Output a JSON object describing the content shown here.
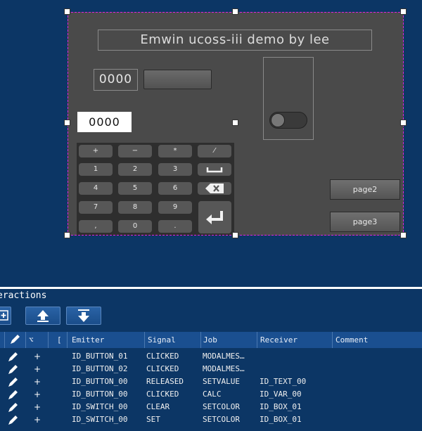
{
  "canvas": {
    "title": "Emwin ucoss-iii demo by lee",
    "display_value": "0000",
    "number_field": "0000",
    "keypad": {
      "row1": [
        "+",
        "−",
        "*",
        "⁄"
      ],
      "row2": [
        "1",
        "2",
        "3"
      ],
      "row3": [
        "4",
        "5",
        "6"
      ],
      "row4": [
        "7",
        "8",
        "9"
      ],
      "row5": [
        ",",
        "0",
        "."
      ]
    },
    "page2_label": "page2",
    "page3_label": "page3"
  },
  "panel": {
    "title": "eractions",
    "headers": [
      "Emitter",
      "Signal",
      "Job",
      "Receiver",
      "Comment"
    ],
    "sort_header": "⌥",
    "bracket_header": "[",
    "rows": [
      {
        "emitter": "ID_BUTTON_01",
        "signal": "CLICKED",
        "job": "MODALMES…",
        "receiver": "",
        "comment": ""
      },
      {
        "emitter": "ID_BUTTON_02",
        "signal": "CLICKED",
        "job": "MODALMES…",
        "receiver": "",
        "comment": ""
      },
      {
        "emitter": "ID_BUTTON_00",
        "signal": "RELEASED",
        "job": "SETVALUE",
        "receiver": "ID_TEXT_00",
        "comment": ""
      },
      {
        "emitter": "ID_BUTTON_00",
        "signal": "CLICKED",
        "job": "CALC",
        "receiver": "ID_VAR_00",
        "comment": ""
      },
      {
        "emitter": "ID_SWITCH_00",
        "signal": "CLEAR",
        "job": "SETCOLOR",
        "receiver": "ID_BOX_01",
        "comment": ""
      },
      {
        "emitter": "ID_SWITCH_00",
        "signal": "SET",
        "job": "SETCOLOR",
        "receiver": "ID_BOX_01",
        "comment": ""
      }
    ]
  }
}
